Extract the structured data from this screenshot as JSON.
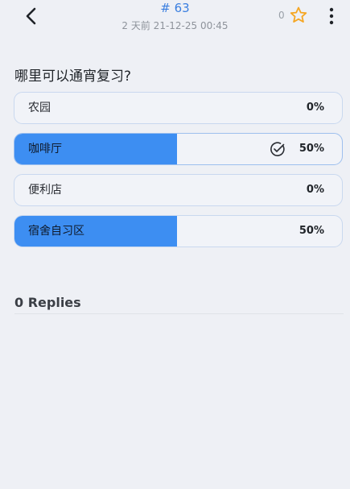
{
  "header": {
    "post_number": "# 63",
    "meta": "2 天前 21-12-25 00:45",
    "favorite_count": "0",
    "back_icon": "chevron-left-icon",
    "favorite_icon": "star-outline-icon",
    "more_icon": "more-vertical-icon"
  },
  "poll": {
    "question": "哪里可以通宵复习?",
    "options": [
      {
        "label": "农园",
        "percent": "0%",
        "share": 0,
        "voted": false
      },
      {
        "label": "咖啡厅",
        "percent": "50%",
        "share": 0.5,
        "voted": true
      },
      {
        "label": "便利店",
        "percent": "0%",
        "share": 0,
        "voted": false
      },
      {
        "label": "宿舍自习区",
        "percent": "50%",
        "share": 0.5,
        "voted": false
      }
    ]
  },
  "replies": {
    "title": "0 Replies"
  },
  "colors": {
    "accent": "#3b7fe0",
    "bar_fill": "#3d8ef2",
    "star": "#f5a623",
    "background": "#eef0f5"
  }
}
